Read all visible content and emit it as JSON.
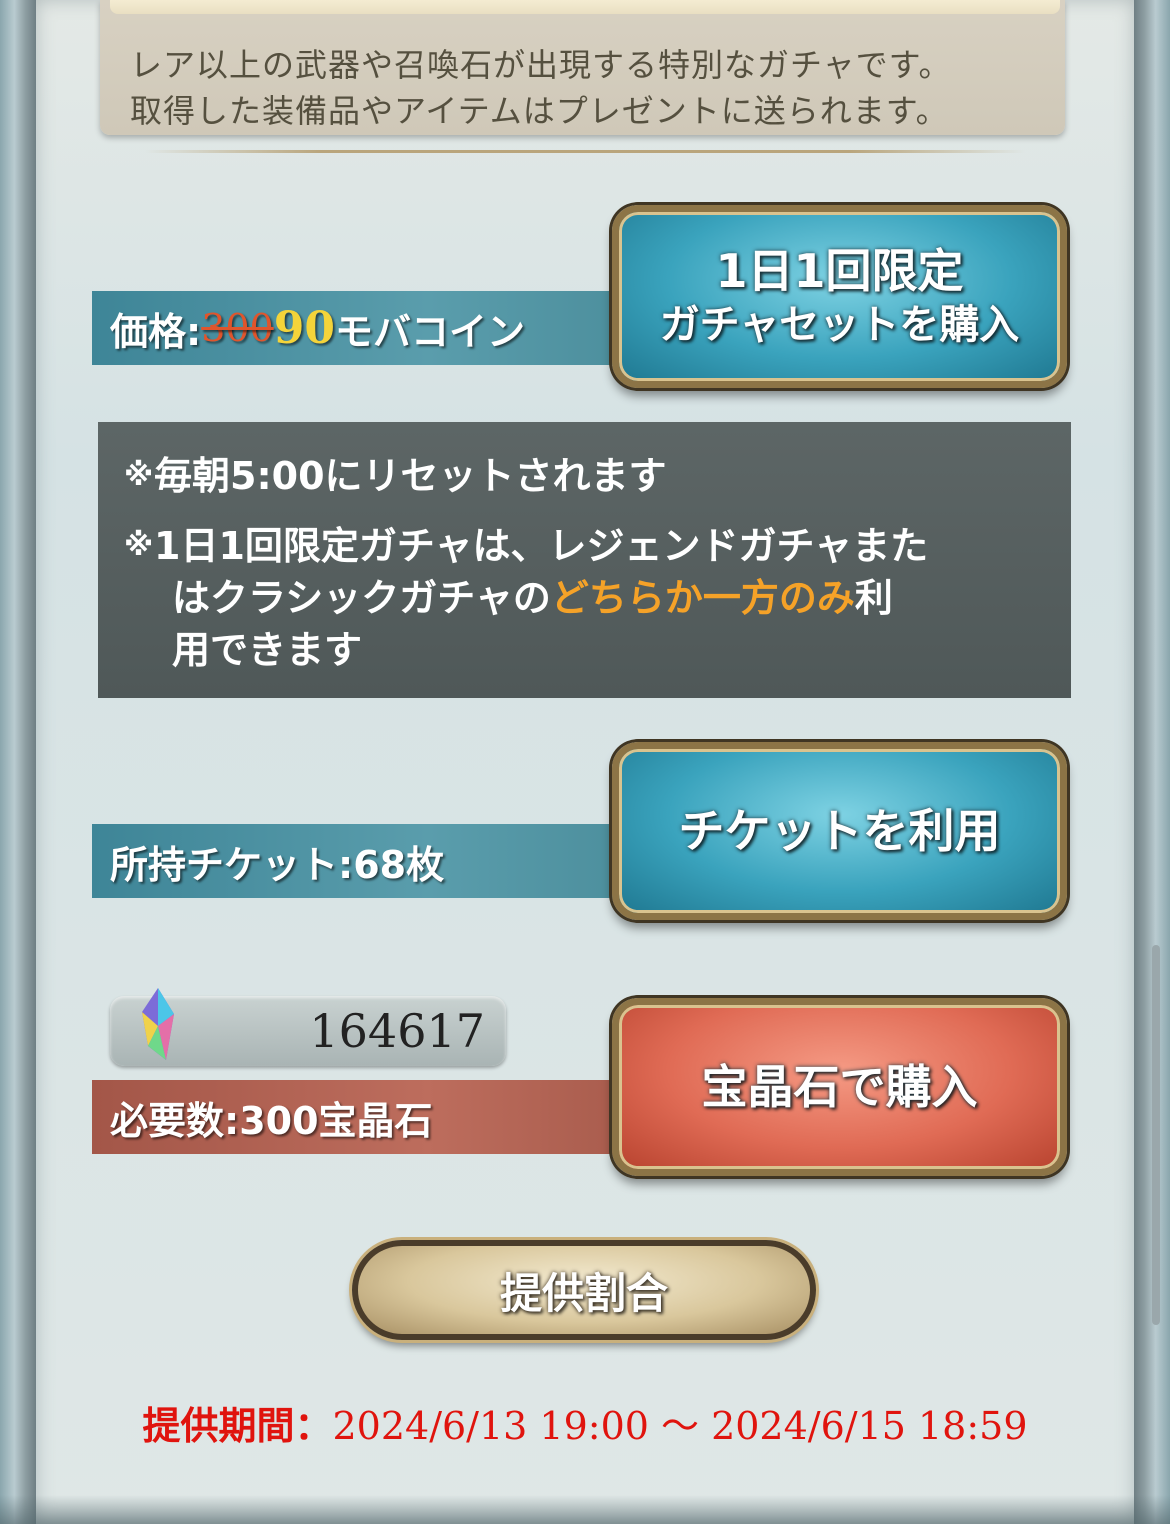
{
  "description": {
    "line1": "レア以上の武器や召喚石が出現する特別なガチャです。",
    "line2": "取得した装備品やアイテムはプレゼントに送られます。"
  },
  "daily": {
    "price_label": "価格:",
    "price_old": "300",
    "price_new": "90",
    "price_unit": "モバコイン",
    "button_line1": "1日1回限定",
    "button_line2": "ガチャセットを購入"
  },
  "notice": {
    "mark": "※",
    "line1": "毎朝5:00にリセットされます",
    "line2_part1": "1日1回限定ガチャは、レジェンドガチャまた",
    "line3_part1": "はクラシックガチャの",
    "line3_highlight": "どちらか一方のみ",
    "line3_part2": "利",
    "line4": "用できます"
  },
  "ticket": {
    "label": "所持チケット:68枚",
    "button": "チケットを利用"
  },
  "crystal": {
    "owned": "164617",
    "required_label": "必要数:300宝晶石",
    "button": "宝晶石で購入"
  },
  "rates_button": "提供割合",
  "period": {
    "label": "提供期間：",
    "value": "2024/6/13 19:00 〜 2024/6/15 18:59"
  },
  "colors": {
    "period_red": "#e0140e",
    "highlight_orange": "#f5a228",
    "strike_red": "#e0552c",
    "price_yellow": "#f4d43a"
  }
}
